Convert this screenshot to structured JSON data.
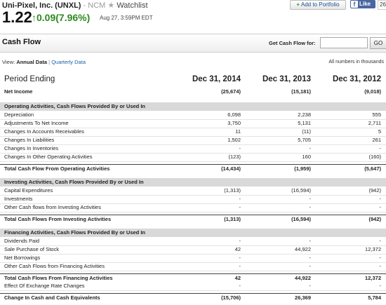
{
  "header": {
    "company": "Uni-Pixel, Inc. (UNXL)",
    "exchange": "- NCM",
    "watchlist_label": "Watchlist",
    "price": "1.22",
    "change": "0.09(7.96%)",
    "timestamp": "Aug 27, 3:59PM EDT",
    "add_portfolio_label": "Add to Portfolio",
    "like_label": "Like",
    "like_count": "26"
  },
  "section": {
    "title": "Cash Flow",
    "get_label": "Get Cash Flow for:",
    "input_value": "",
    "go_label": "GO"
  },
  "view": {
    "prefix": "View:",
    "annual": "Annual Data",
    "separator": "|",
    "quarterly": "Quarterly Data",
    "units": "All numbers in thousands"
  },
  "colors": {
    "positive": "#2e8a1f",
    "link": "#1a5ea8",
    "section_bg": "#d9d9d9"
  },
  "table": {
    "period_label": "Period Ending",
    "periods": [
      "Dec 31, 2014",
      "Dec 31, 2013",
      "Dec 31, 2012"
    ],
    "rows": [
      {
        "label": "Net Income",
        "values": [
          "(25,674)",
          "(15,181)",
          "(9,018)"
        ],
        "style": "bold"
      },
      {
        "label": "Operating Activities, Cash Flows Provided By or Used In",
        "values": [
          "",
          "",
          ""
        ],
        "style": "section"
      },
      {
        "label": "Depreciation",
        "values": [
          "6,098",
          "2,238",
          "555"
        ],
        "style": "normal"
      },
      {
        "label": "Adjustments To Net Income",
        "values": [
          "3,750",
          "5,131",
          "2,711"
        ],
        "style": "normal"
      },
      {
        "label": "Changes In Accounts Receivables",
        "values": [
          "11",
          "(11)",
          "5"
        ],
        "style": "normal"
      },
      {
        "label": "Changes In Liabilities",
        "values": [
          "1,502",
          "5,705",
          "261"
        ],
        "style": "normal"
      },
      {
        "label": "Changes In Inventories",
        "values": [
          "-",
          "-",
          "-"
        ],
        "style": "normal"
      },
      {
        "label": "Changes In Other Operating Activities",
        "values": [
          "(123)",
          "160",
          "(160)"
        ],
        "style": "normal"
      },
      {
        "label": "Total Cash Flow From Operating Activities",
        "values": [
          "(14,434)",
          "(1,959)",
          "(5,647)"
        ],
        "style": "total"
      },
      {
        "label": "Investing Activities, Cash Flows Provided By or Used In",
        "values": [
          "",
          "",
          ""
        ],
        "style": "section"
      },
      {
        "label": "Capital Expenditures",
        "values": [
          "(1,313)",
          "(16,594)",
          "(942)"
        ],
        "style": "normal"
      },
      {
        "label": "Investments",
        "values": [
          "-",
          "-",
          "-"
        ],
        "style": "normal"
      },
      {
        "label": "Other Cash flows from Investing Activities",
        "values": [
          "-",
          "-",
          "-"
        ],
        "style": "normal"
      },
      {
        "label": "Total Cash Flows From Investing Activities",
        "values": [
          "(1,313)",
          "(16,594)",
          "(942)"
        ],
        "style": "total"
      },
      {
        "label": "Financing Activities, Cash Flows Provided By or Used In",
        "values": [
          "",
          "",
          ""
        ],
        "style": "section"
      },
      {
        "label": "Dividends Paid",
        "values": [
          "-",
          "-",
          "-"
        ],
        "style": "normal"
      },
      {
        "label": "Sale Purchase of Stock",
        "values": [
          "42",
          "44,922",
          "12,372"
        ],
        "style": "normal"
      },
      {
        "label": "Net Borrowings",
        "values": [
          "-",
          "-",
          "-"
        ],
        "style": "normal"
      },
      {
        "label": "Other Cash Flows from Financing Activities",
        "values": [
          "-",
          "-",
          "-"
        ],
        "style": "normal"
      },
      {
        "label": "Total Cash Flows From Financing Activities",
        "values": [
          "42",
          "44,922",
          "12,372"
        ],
        "style": "total"
      },
      {
        "label": "Effect Of Exchange Rate Changes",
        "values": [
          "-",
          "-",
          "-"
        ],
        "style": "normal"
      },
      {
        "label": "Change In Cash and Cash Equivalents",
        "values": [
          "(15,706)",
          "26,369",
          "5,784"
        ],
        "style": "total"
      }
    ]
  }
}
